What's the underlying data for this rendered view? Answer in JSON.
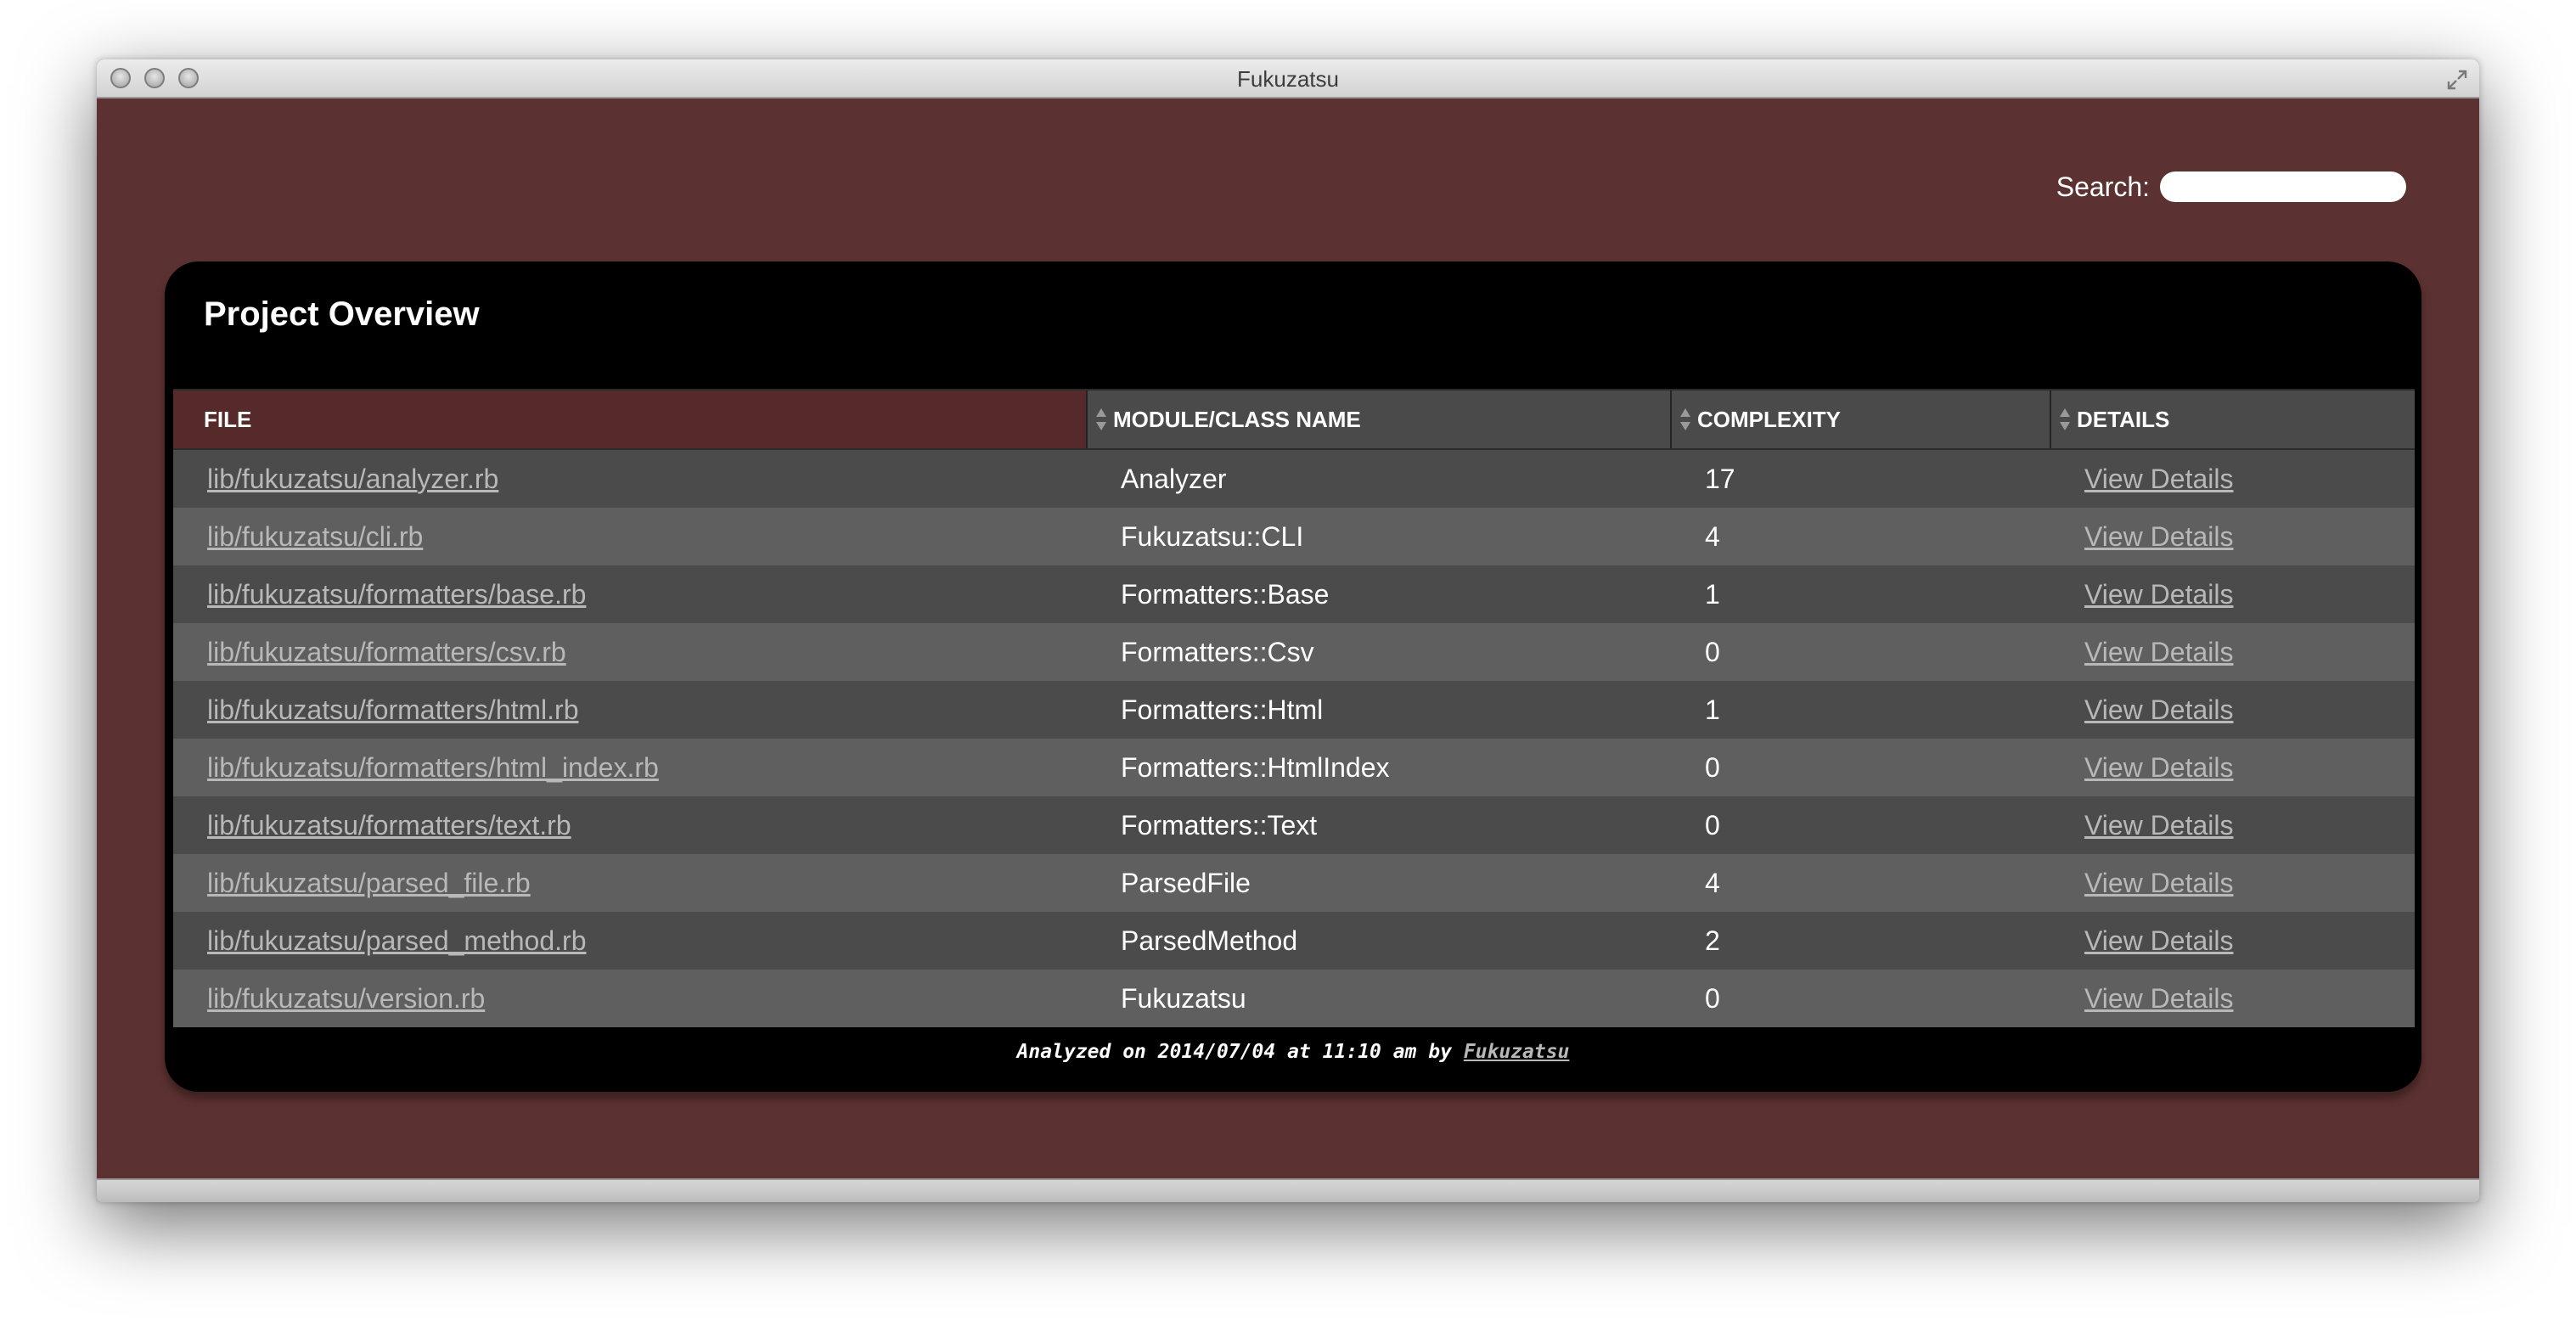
{
  "window": {
    "title": "Fukuzatsu"
  },
  "search": {
    "label": "Search:",
    "value": "",
    "placeholder": ""
  },
  "panel": {
    "title": "Project Overview"
  },
  "table": {
    "columns": [
      "FILE",
      "MODULE/CLASS NAME",
      "COMPLEXITY",
      "DETAILS"
    ],
    "rows": [
      {
        "file": "lib/fukuzatsu/analyzer.rb",
        "module": "Analyzer",
        "complexity": "17",
        "details": "View Details"
      },
      {
        "file": "lib/fukuzatsu/cli.rb",
        "module": "Fukuzatsu::CLI",
        "complexity": "4",
        "details": "View Details"
      },
      {
        "file": "lib/fukuzatsu/formatters/base.rb",
        "module": "Formatters::Base",
        "complexity": "1",
        "details": "View Details"
      },
      {
        "file": "lib/fukuzatsu/formatters/csv.rb",
        "module": "Formatters::Csv",
        "complexity": "0",
        "details": "View Details"
      },
      {
        "file": "lib/fukuzatsu/formatters/html.rb",
        "module": "Formatters::Html",
        "complexity": "1",
        "details": "View Details"
      },
      {
        "file": "lib/fukuzatsu/formatters/html_index.rb",
        "module": "Formatters::HtmlIndex",
        "complexity": "0",
        "details": "View Details"
      },
      {
        "file": "lib/fukuzatsu/formatters/text.rb",
        "module": "Formatters::Text",
        "complexity": "0",
        "details": "View Details"
      },
      {
        "file": "lib/fukuzatsu/parsed_file.rb",
        "module": "ParsedFile",
        "complexity": "4",
        "details": "View Details"
      },
      {
        "file": "lib/fukuzatsu/parsed_method.rb",
        "module": "ParsedMethod",
        "complexity": "2",
        "details": "View Details"
      },
      {
        "file": "lib/fukuzatsu/version.rb",
        "module": "Fukuzatsu",
        "complexity": "0",
        "details": "View Details"
      }
    ]
  },
  "footer": {
    "text": "Analyzed on 2014/07/04 at 11:10 am by ",
    "link": "Fukuzatsu"
  },
  "icons": {
    "window_buttons": [
      "close-icon",
      "minimize-icon",
      "zoom-icon"
    ],
    "fullscreen": "fullscreen-icon",
    "sort": "sort-icon"
  },
  "colors": {
    "background": "#5c3131",
    "panel": "#000000",
    "row_dark": "#4b4b4b",
    "row_light": "#5f5f5f",
    "link": "#b8b8b8"
  }
}
